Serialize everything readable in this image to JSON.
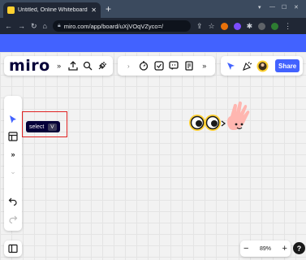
{
  "browser": {
    "tab_title": "Untitled, Online Whiteboard for",
    "tab_close": "✕",
    "new_tab": "+",
    "url": "miro.com/app/board/uXjVOqVZyco=/",
    "colors": {
      "tabbar": "#3b4a5e",
      "toolbar": "#202735",
      "banner": "#4262ff"
    }
  },
  "header": {
    "logo": "miro",
    "share_label": "Share"
  },
  "tooltip": {
    "label": "select",
    "shortcut": "V"
  },
  "zoom": {
    "minus": "−",
    "level": "89%",
    "plus": "+",
    "help": "?"
  },
  "colors": {
    "accent": "#4262ff",
    "select_tool": "#4262ff",
    "highlight": "#e02222"
  }
}
